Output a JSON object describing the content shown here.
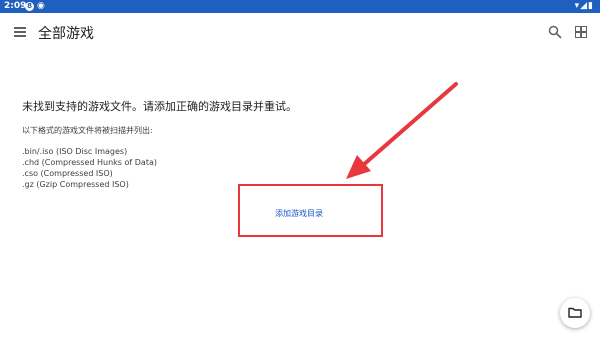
{
  "status_bar": {
    "time": "2:09",
    "indicator_badge": "8",
    "indicator_extra": "◉",
    "right_icons": "▾◢▮"
  },
  "app_bar": {
    "title": "全部游戏",
    "icons": [
      "menu-icon",
      "search-icon",
      "grid-view-icon"
    ]
  },
  "main": {
    "message": "未找到支持的游戏文件。请添加正确的游戏目录并重试。",
    "formats_intro": "以下格式的游戏文件将被扫描并列出:",
    "formats": [
      ".bin/.iso (ISO Disc Images)",
      ".chd (Compressed Hunks of Data)",
      ".cso (Compressed ISO)",
      ".gz (Gzip Compressed ISO)"
    ],
    "add_directory_label": "添加游戏目录"
  },
  "annotation": {
    "color": "#e8383d"
  },
  "colors": {
    "status_bar_bg": "#1f5fbf",
    "link": "#1a56c9"
  },
  "fab": {
    "icon": "folder-icon"
  }
}
